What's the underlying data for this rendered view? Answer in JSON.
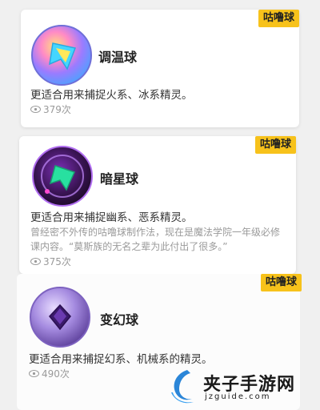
{
  "items": [
    {
      "tag": "咕噜球",
      "name": "调温球",
      "desc": "更适合用来捕捉火系、冰系精灵。",
      "views": "379次",
      "icon": "rainbow-star-ball-icon"
    },
    {
      "tag": "咕噜球",
      "name": "暗星球",
      "desc": "更适合用来捕捉幽系、恶系精灵。",
      "lore": "曾经密不外传的咕噜球制作法，现在是魔法学院一年级必修课内容。“莫斯族的无名之辈为此付出了很多。”",
      "views": "375次",
      "icon": "dark-star-ball-icon"
    },
    {
      "tag": "咕噜球",
      "name": "变幻球",
      "desc": "更适合用来捕捉幻系、机械系的精灵。",
      "views": "490次",
      "icon": "crystal-ball-icon"
    }
  ],
  "watermark": {
    "text": "夹子手游网",
    "url": "jzguide.com"
  },
  "colors": {
    "tag_bg": "#f7c21b",
    "page_bg": "#f0f0f0"
  }
}
